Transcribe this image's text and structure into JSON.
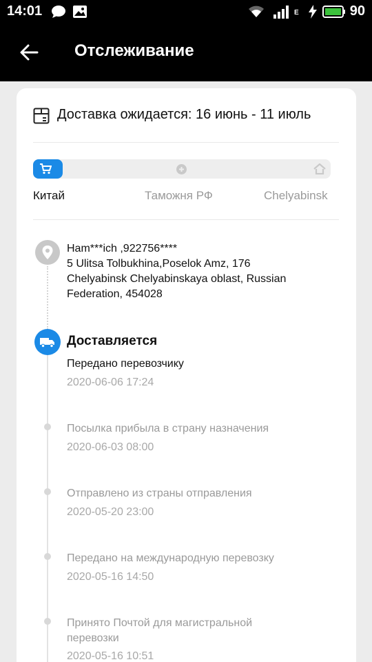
{
  "status_bar": {
    "time": "14:01",
    "network_label": "E",
    "battery": "90"
  },
  "header": {
    "title": "Отслеживание"
  },
  "delivery": {
    "expected_text": "Доставка ожидается: 16 июнь - 11 июль"
  },
  "progress": {
    "fraction": 0.1,
    "stages": [
      {
        "label": "Китай",
        "active": true
      },
      {
        "label": "Таможня РФ",
        "active": false
      },
      {
        "label": "Chelyabinsk",
        "active": false
      }
    ]
  },
  "address": {
    "line1": "Ham***ich ,922756****",
    "line2": "5 Ulitsa Tolbukhina,Poselok Amz, 176",
    "line3": "Chelyabinsk Chelyabinskaya oblast, Russian",
    "line4": "Federation, 454028"
  },
  "current_status": {
    "title": "Доставляется"
  },
  "events": [
    {
      "description": "Передано перевозчику",
      "time": "2020-06-06 17:24"
    },
    {
      "description": "Посылка прибыла в страну назначения",
      "time": "2020-06-03 08:00"
    },
    {
      "description": "Отправлено из страны отправления",
      "time": "2020-05-20 23:00"
    },
    {
      "description": "Передано на международную перевозку",
      "time": "2020-05-16 14:50"
    },
    {
      "description": "Принято Почтой для магистральной перевозки",
      "time": "2020-05-16 10:51"
    }
  ],
  "colors": {
    "accent": "#1b8ae6",
    "inactive_text": "#9a9a9a"
  }
}
